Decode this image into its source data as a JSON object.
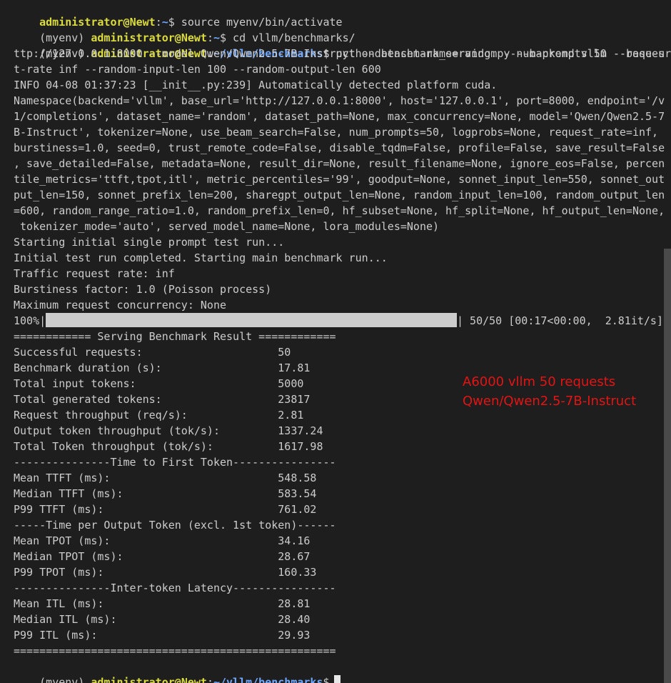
{
  "prompt": {
    "env": "(myenv) ",
    "user": "administrator",
    "at": "@",
    "host": "Newt",
    "sep": ":",
    "home": "~",
    "cwd": "~/vllm/benchmarks",
    "dollar": "$"
  },
  "commands": {
    "c1": " source myenv/bin/activate",
    "c2": " cd vllm/benchmarks/",
    "c3": " python benchmark_serving.py --backend vllm --base-url h"
  },
  "output_lines": [
    "ttp://127.0.0.1:8000 --model Qwen/Qwen2.5-7B-Instruct --dataset-name=random --num-prompts 50 --reques",
    "t-rate inf --random-input-len 100 --random-output-len 600",
    "INFO 04-08 01:37:23 [__init__.py:239] Automatically detected platform cuda.",
    "Namespace(backend='vllm', base_url='http://127.0.0.1:8000', host='127.0.0.1', port=8000, endpoint='/v",
    "1/completions', dataset_name='random', dataset_path=None, max_concurrency=None, model='Qwen/Qwen2.5-7",
    "B-Instruct', tokenizer=None, use_beam_search=False, num_prompts=50, logprobs=None, request_rate=inf,",
    "burstiness=1.0, seed=0, trust_remote_code=False, disable_tqdm=False, profile=False, save_result=False",
    ", save_detailed=False, metadata=None, result_dir=None, result_filename=None, ignore_eos=False, percen",
    "tile_metrics='ttft,tpot,itl', metric_percentiles='99', goodput=None, sonnet_input_len=550, sonnet_out",
    "put_len=150, sonnet_prefix_len=200, sharegpt_output_len=None, random_input_len=100, random_output_len",
    "=600, random_range_ratio=1.0, random_prefix_len=0, hf_subset=None, hf_split=None, hf_output_len=None,",
    " tokenizer_mode='auto', served_model_name=None, lora_modules=None)",
    "Starting initial single prompt test run...",
    "Initial test run completed. Starting main benchmark run...",
    "Traffic request rate: inf",
    "Burstiness factor: 1.0 (Poisson process)",
    "Maximum request concurrency: None"
  ],
  "progress": {
    "percent_label": "100%|",
    "fraction_complete": 1.0,
    "tail": "| 50/50 [00:17<00:00,  2.81it/s]"
  },
  "results_lines": [
    "============ Serving Benchmark Result ============",
    "Successful requests:                     50",
    "Benchmark duration (s):                  17.81",
    "Total input tokens:                      5000",
    "Total generated tokens:                  23817",
    "Request throughput (req/s):              2.81",
    "Output token throughput (tok/s):         1337.24",
    "Total Token throughput (tok/s):          1617.98",
    "---------------Time to First Token----------------",
    "Mean TTFT (ms):                          548.58",
    "Median TTFT (ms):                        583.54",
    "P99 TTFT (ms):                           761.02",
    "-----Time per Output Token (excl. 1st token)------",
    "Mean TPOT (ms):                          34.16",
    "Median TPOT (ms):                        28.67",
    "P99 TPOT (ms):                           160.33",
    "---------------Inter-token Latency----------------",
    "Mean ITL (ms):                           28.81",
    "Median ITL (ms):                         28.40",
    "P99 ITL (ms):                            29.93",
    "=================================================="
  ],
  "annotation": {
    "line1": "A6000 vllm 50 requests",
    "line2": "Qwen/Qwen2.5-7B-Instruct"
  },
  "colors": {
    "background": "#1e1e1e",
    "text": "#cccccc",
    "user_host": "#dcdc3c",
    "path": "#6ea8ff",
    "annotation": "#e51414"
  }
}
